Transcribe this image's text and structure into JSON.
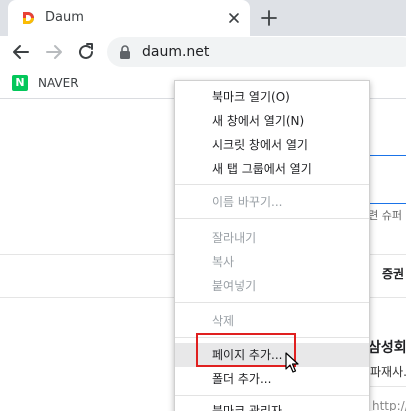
{
  "tab": {
    "title": "Daum",
    "favicon_color": "#1a73e8"
  },
  "toolbar": {
    "url": "daum.net"
  },
  "bookmarks": [
    {
      "label": "NAVER",
      "icon": "naver-n-icon",
      "color": "#03c75a"
    }
  ],
  "page": {
    "right_text_1": "등련 슈퍼",
    "right_text_2": "증권",
    "right_text_3": "삼성회",
    "right_text_4": "파재사.",
    "right_text_5": "http://D"
  },
  "context_menu": {
    "items": [
      {
        "label": "북마크 열기(O)",
        "enabled": true
      },
      {
        "label": "새 창에서 열기(N)",
        "enabled": true
      },
      {
        "label": "시크릿 창에서 열기",
        "enabled": true
      },
      {
        "label": "새 탭 그룹에서 열기",
        "enabled": true
      },
      {
        "label": "이름 바꾸기...",
        "enabled": false
      },
      {
        "label": "잘라내기",
        "enabled": false
      },
      {
        "label": "복사",
        "enabled": false
      },
      {
        "label": "붙여넣기",
        "enabled": false
      },
      {
        "label": "삭제",
        "enabled": false
      },
      {
        "label": "페이지 추가...",
        "enabled": true,
        "hovered": true
      },
      {
        "label": "폴더 추가...",
        "enabled": true
      },
      {
        "label": "북마크 관리자",
        "enabled": true
      }
    ]
  },
  "annotation": {
    "color": "#e02020"
  }
}
